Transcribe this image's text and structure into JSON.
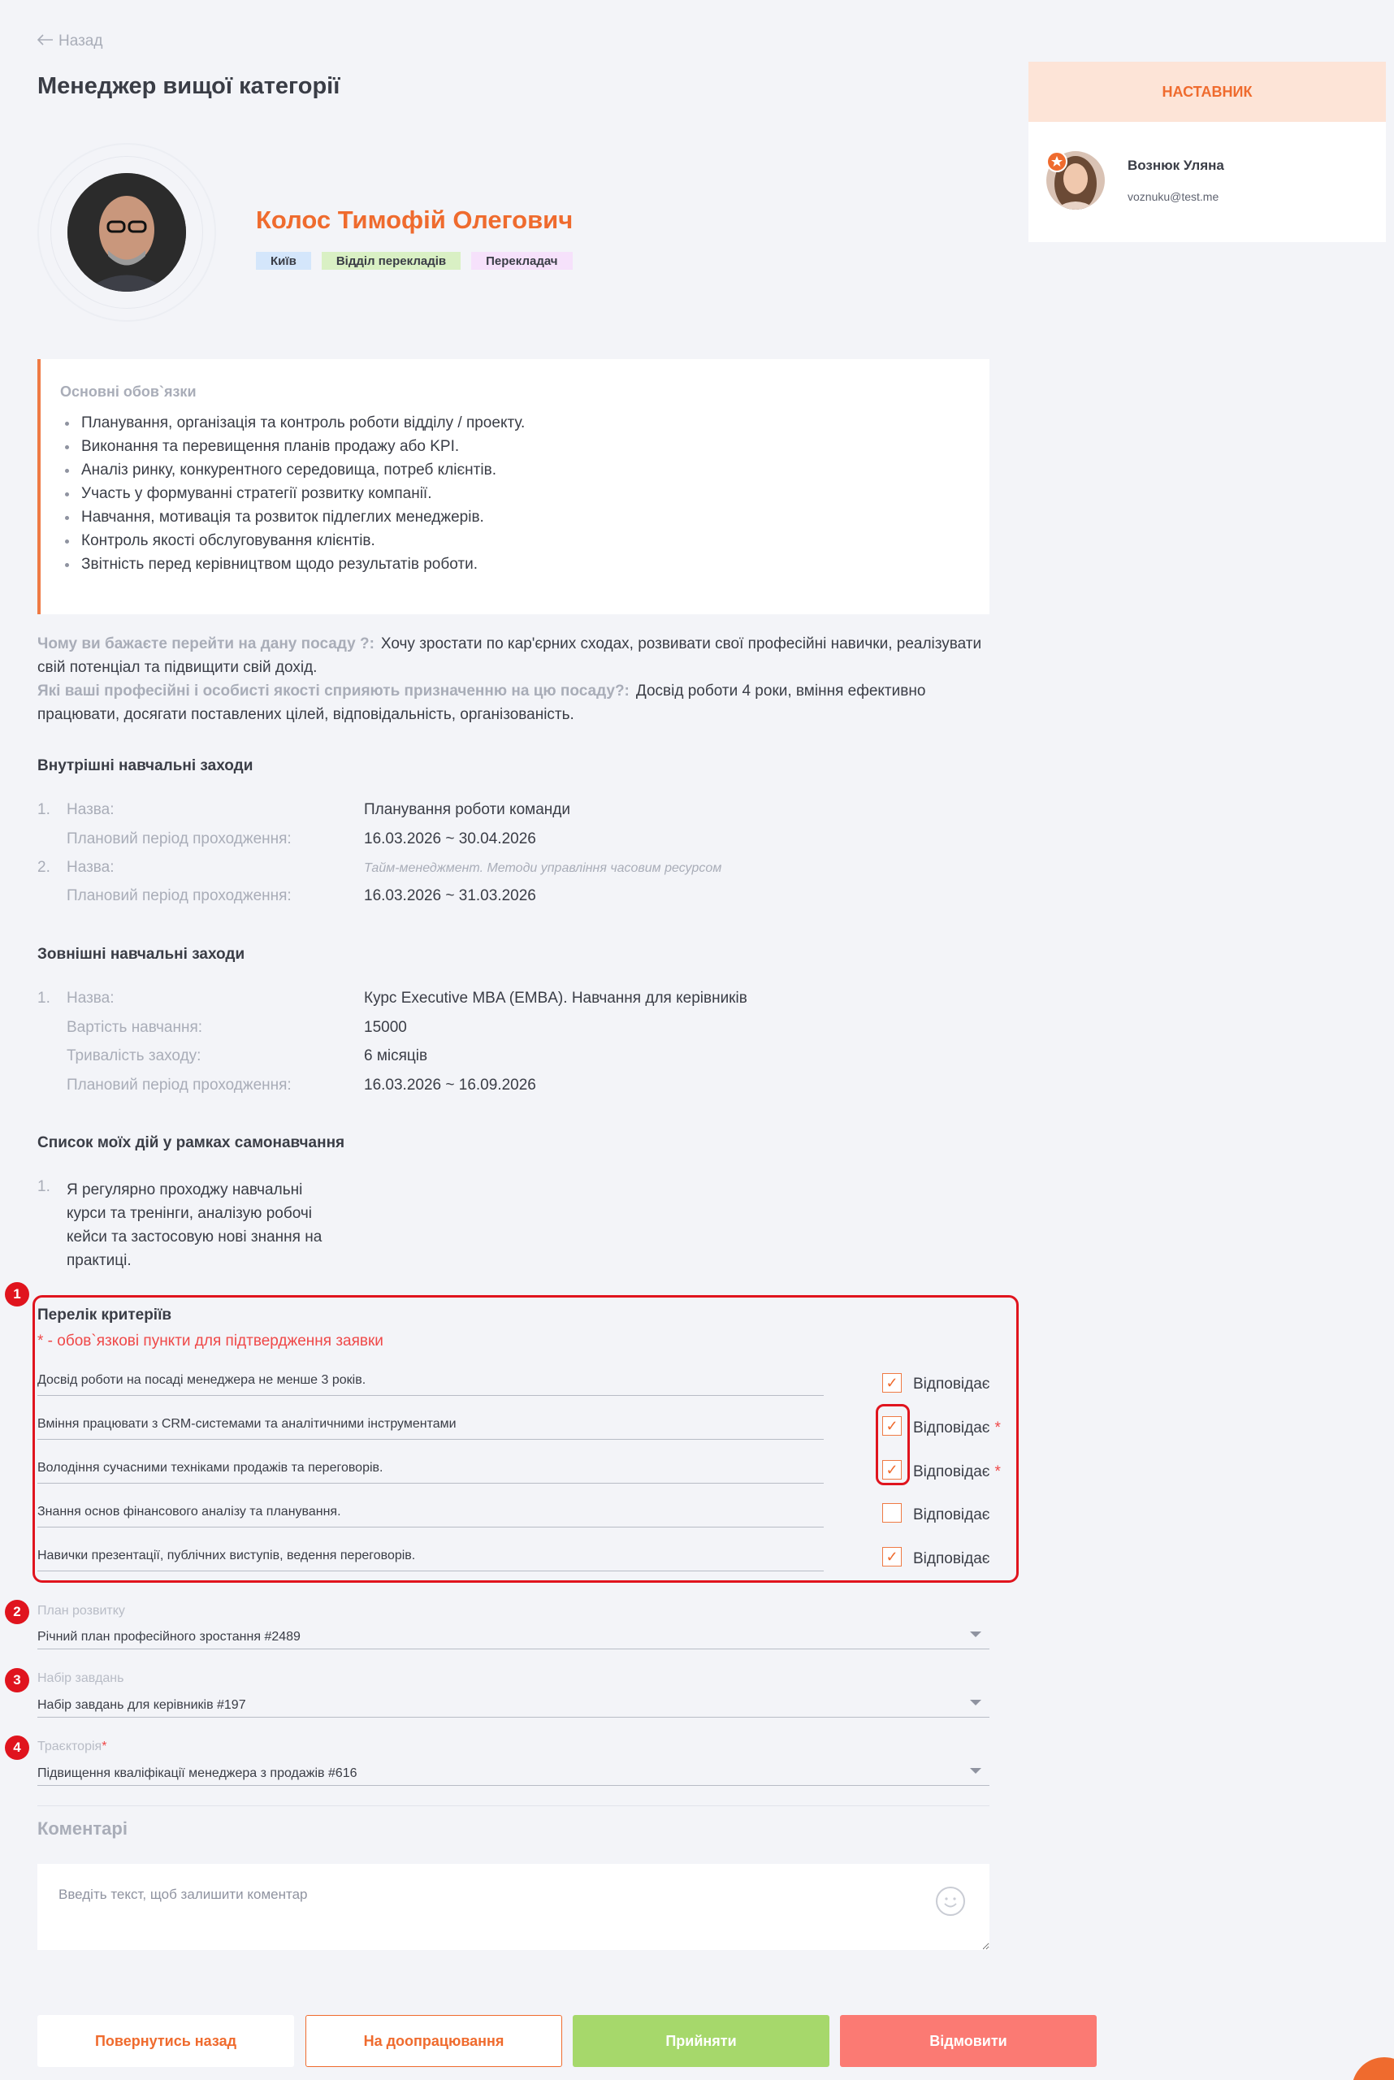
{
  "nav": {
    "back_link": "Назад"
  },
  "page": {
    "title": "Менеджер вищої категорії"
  },
  "person": {
    "name": "Колос Тимофій Олегович",
    "tags": [
      {
        "label": "Київ",
        "color": "#d4e6fb"
      },
      {
        "label": "Відділ перекладів",
        "color": "#d9f0c4"
      },
      {
        "label": "Перекладач",
        "color": "#f6e1fb"
      }
    ]
  },
  "mentor": {
    "header": "НАСТАВНИК",
    "name": "Вознюк Уляна",
    "email": "voznuku@test.me"
  },
  "duties": {
    "title": "Основні обов`язки",
    "items": [
      "Планування, організація та контроль роботи відділу / проекту.",
      "Виконання та перевищення планів продажу або KPI.",
      "Аналіз ринку, конкурентного середовища, потреб клієнтів.",
      "Участь у формуванні стратегії розвитку компанії.",
      "Навчання, мотивація та розвиток підлеглих менеджерів.",
      "Контроль якості обслуговування клієнтів.",
      "Звітність перед керівництвом щодо результатів роботи."
    ]
  },
  "questions": [
    {
      "q": "Чому ви бажаєте перейти на дану посаду ?:",
      "a": "Хочу зростати по кар'єрних сходах, розвивати свої професійні навички, реалізувати свій потенціал та підвищити свій дохід."
    },
    {
      "q": "Які ваші професійні і особисті якості сприяють призначенню на цю посаду?:",
      "a": "Досвід роботи 4 роки, вміння ефективно працювати, досягати поставлених цілей, відповідальність, організованість."
    }
  ],
  "internal": {
    "title": "Внутрішні навчальні заходи",
    "items": [
      {
        "num": "1.",
        "name_label": "Назва:",
        "name": "Планування роботи команди",
        "period_label": "Плановий період проходження:",
        "period": "16.03.2026 ~ 30.04.2026"
      },
      {
        "num": "2.",
        "name_label": "Назва:",
        "name": "Тайм-менеджмент. Методи управління часовим ресурсом",
        "period_label": "Плановий період проходження:",
        "period": "16.03.2026 ~ 31.03.2026"
      }
    ]
  },
  "external": {
    "title": "Зовнішні навчальні заходи",
    "num": "1.",
    "name_label": "Назва:",
    "name": "Курс Executive MBA (EMBA). Навчання для керівників",
    "cost_label": "Вартість навчання:",
    "cost": "15000",
    "duration_label": "Тривалість заходу:",
    "duration": "6 місяців",
    "period_label": "Плановий період проходження:",
    "period": "16.03.2026 ~ 16.09.2026"
  },
  "self_study": {
    "title": "Список моїх дій у рамках самонавчання",
    "num": "1.",
    "lines": [
      "Я регулярно проходжу навчальні",
      "курси та тренінги, аналізую робочі",
      "кейси та застосовую нові знання на",
      "практиці."
    ]
  },
  "callouts": [
    "1",
    "2",
    "3",
    "4"
  ],
  "criteria": {
    "title": "Перелік критеріїв",
    "note": "* - обов`язкові пункти для підтвердження заявки",
    "check_label": "Відповідає",
    "required_mark": "*",
    "items": [
      {
        "text": "Досвід роботи на посаді менеджера не менше 3 років.",
        "checked": true,
        "required": false
      },
      {
        "text": "Вміння працювати з CRM-системами та аналітичними інструментами",
        "checked": true,
        "required": true
      },
      {
        "text": "Володіння сучасними техніками продажів та переговорів.",
        "checked": true,
        "required": true
      },
      {
        "text": "Знання основ фінансового аналізу та планування.",
        "checked": false,
        "required": false
      },
      {
        "text": "Навички презентації, публічних виступів, ведення переговорів.",
        "checked": true,
        "required": false
      }
    ]
  },
  "selects": {
    "plan": {
      "label": "План розвитку",
      "value": "Річний план професійного зростання #2489"
    },
    "tasks": {
      "label": "Набір завдань",
      "value": "Набір завдань для керівників #197"
    },
    "trajectory": {
      "label": "Траєкторія",
      "required_mark": "*",
      "value": "Підвищення кваліфікації менеджера з продажів #616"
    }
  },
  "comments": {
    "title": "Коментарі",
    "placeholder": "Введіть текст, щоб залишити коментар"
  },
  "buttons": {
    "back": "Повернутись назад",
    "rework": "На доопрацювання",
    "accept": "Прийняти",
    "reject": "Відмовити"
  },
  "check_glyph": "✓",
  "colors": {
    "accent": "#ef6b2e",
    "highlight": "#e0141e",
    "accept": "#a6d86b",
    "reject": "#fb7a73"
  }
}
